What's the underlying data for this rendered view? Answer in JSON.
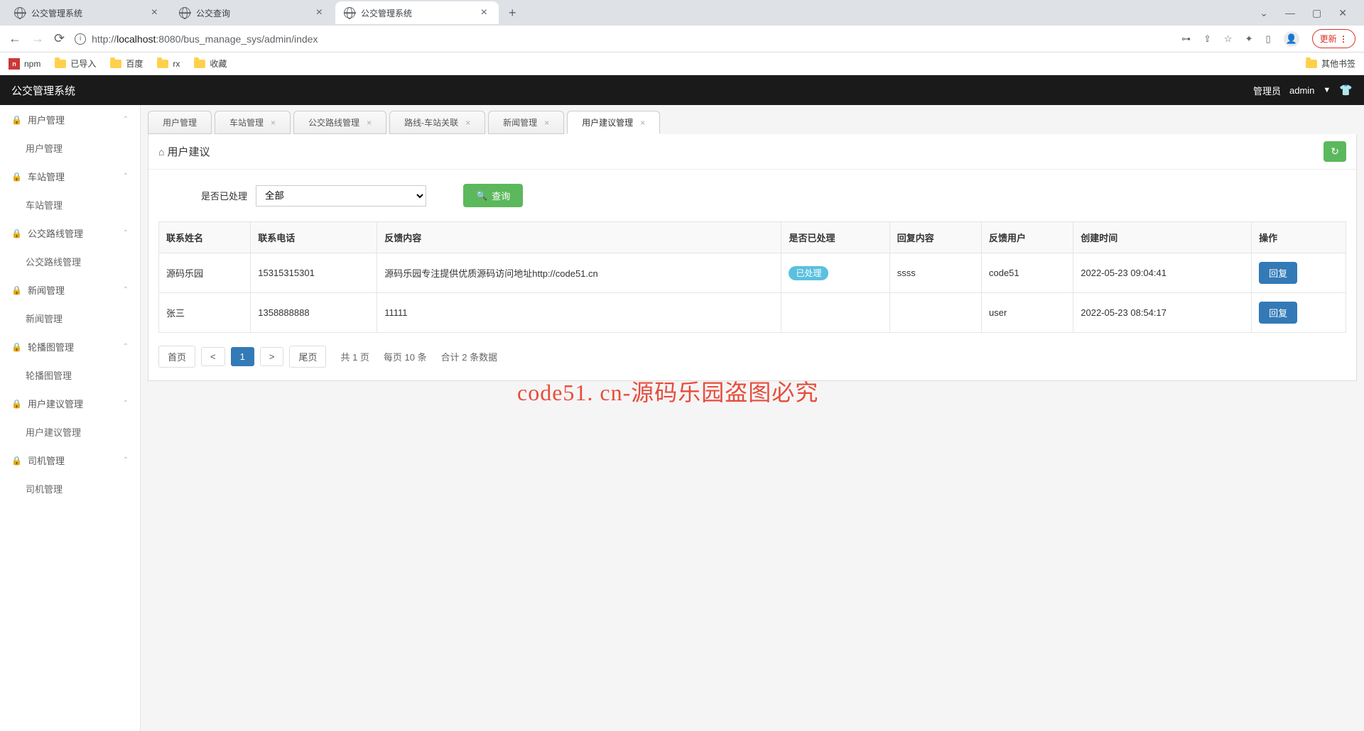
{
  "browser": {
    "tabs": [
      {
        "title": "公交管理系统",
        "active": false
      },
      {
        "title": "公交查询",
        "active": false
      },
      {
        "title": "公交管理系统",
        "active": true
      }
    ],
    "url_proto": "http://",
    "url_host": "localhost",
    "url_port": ":8080",
    "url_path": "/bus_manage_sys/admin/index",
    "update_label": "更新",
    "bookmarks": [
      {
        "label": "npm",
        "icon": "npm"
      },
      {
        "label": "已导入",
        "icon": "folder"
      },
      {
        "label": "百度",
        "icon": "folder"
      },
      {
        "label": "rx",
        "icon": "folder"
      },
      {
        "label": "收藏",
        "icon": "folder"
      }
    ],
    "other_bookmarks": "其他书签"
  },
  "app": {
    "title": "公交管理系统",
    "role_label": "管理员",
    "username": "admin"
  },
  "sidebar": [
    {
      "label": "用户管理",
      "children": [
        {
          "label": "用户管理"
        }
      ]
    },
    {
      "label": "车站管理",
      "children": [
        {
          "label": "车站管理"
        }
      ]
    },
    {
      "label": "公交路线管理",
      "children": [
        {
          "label": "公交路线管理"
        }
      ]
    },
    {
      "label": "新闻管理",
      "children": [
        {
          "label": "新闻管理"
        }
      ]
    },
    {
      "label": "轮播图管理",
      "children": [
        {
          "label": "轮播图管理"
        }
      ]
    },
    {
      "label": "用户建议管理",
      "children": [
        {
          "label": "用户建议管理"
        }
      ]
    },
    {
      "label": "司机管理",
      "children": [
        {
          "label": "司机管理"
        }
      ]
    }
  ],
  "inner_tabs": [
    {
      "label": "用户管理",
      "closable": false,
      "active": false
    },
    {
      "label": "车站管理",
      "closable": true,
      "active": false
    },
    {
      "label": "公交路线管理",
      "closable": true,
      "active": false
    },
    {
      "label": "路线-车站关联",
      "closable": true,
      "active": false
    },
    {
      "label": "新闻管理",
      "closable": true,
      "active": false
    },
    {
      "label": "用户建议管理",
      "closable": true,
      "active": true
    }
  ],
  "breadcrumb": "用户建议",
  "filter": {
    "label": "是否已处理",
    "selected": "全部",
    "query_label": "查询"
  },
  "table": {
    "headers": [
      "联系姓名",
      "联系电话",
      "反馈内容",
      "是否已处理",
      "回复内容",
      "反馈用户",
      "创建时间",
      "操作"
    ],
    "rows": [
      {
        "name": "源码乐园",
        "phone": "15315315301",
        "content": "源码乐园专注提供优质源码访问地址http://code51.cn",
        "processed": "已处理",
        "reply": "ssss",
        "user": "code51",
        "created": "2022-05-23 09:04:41",
        "action": "回复"
      },
      {
        "name": "张三",
        "phone": "1358888888",
        "content": "11111",
        "processed": "",
        "reply": "",
        "user": "user",
        "created": "2022-05-23 08:54:17",
        "action": "回复"
      }
    ]
  },
  "pagination": {
    "first": "首页",
    "prev": "<",
    "current": "1",
    "next": ">",
    "last": "尾页",
    "info1": "共 1 页",
    "info2": "每页 10 条",
    "info3": "合计 2 条数据"
  },
  "watermark": "code51. cn-源码乐园盗图必究"
}
